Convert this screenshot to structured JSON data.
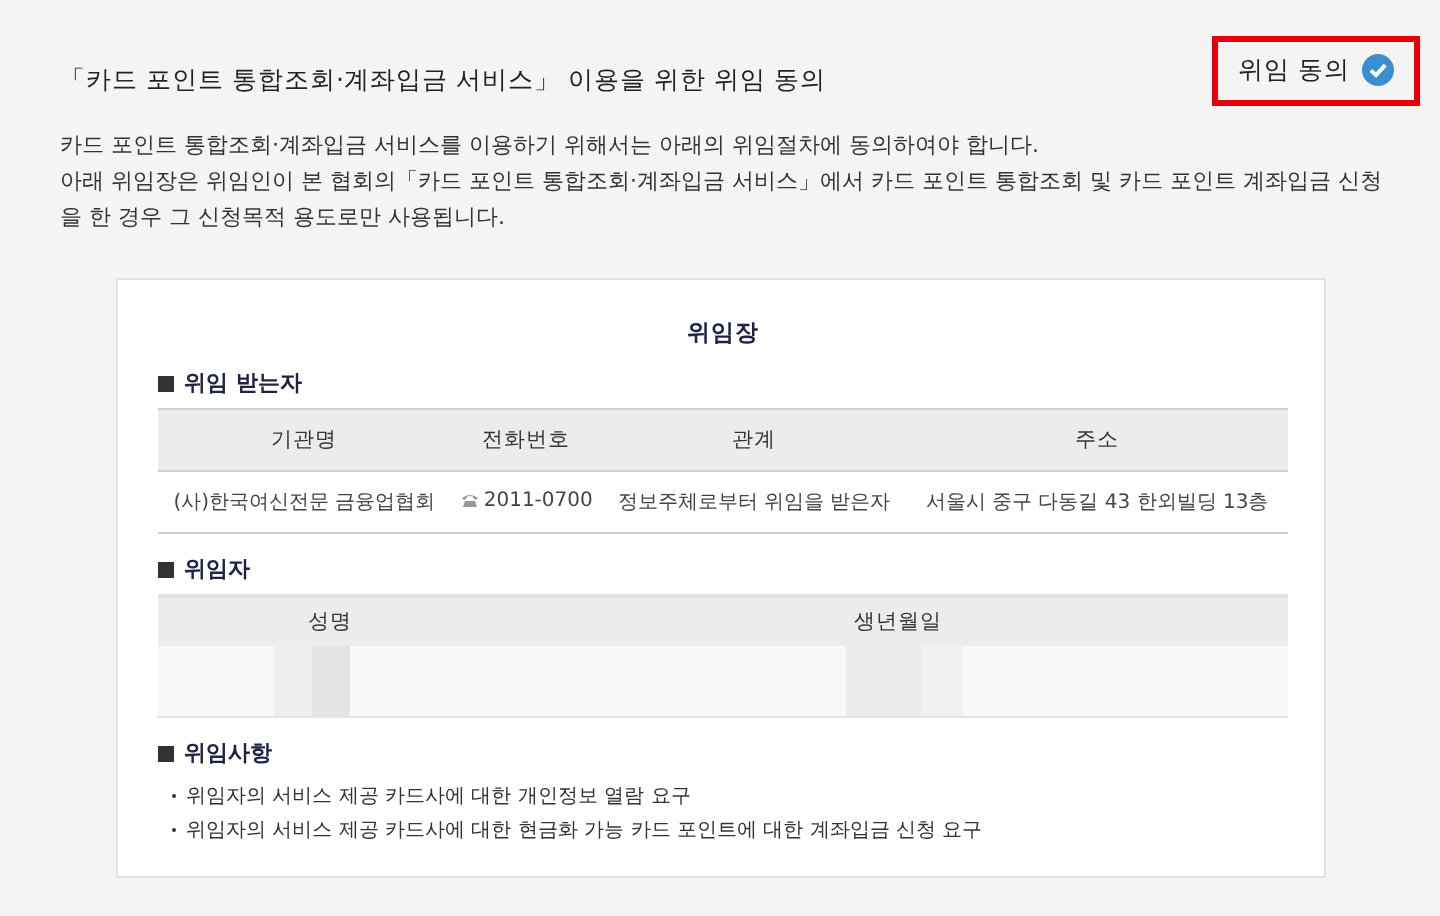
{
  "header": {
    "title": "「카드 포인트 통합조회·계좌입금 서비스」 이용을 위한 위임 동의",
    "consent": {
      "label": "위임 동의",
      "checked": true,
      "highlighted": true
    }
  },
  "intro": [
    "카드 포인트 통합조회·계좌입금 서비스를 이용하기 위해서는 아래의 위임절차에 동의하여야 합니다.",
    "아래 위임장은 위임인이 본 협회의「카드 포인트 통합조회·계좌입금 서비스」에서 카드 포인트 통합조회 및 카드 포인트 계좌입금 신청을 한 경우 그 신청목적 용도로만 사용됩니다."
  ],
  "document": {
    "title": "위임장",
    "grantee": {
      "heading": "위임 받는자",
      "columns": [
        "기관명",
        "전화번호",
        "관계",
        "주소"
      ],
      "row": [
        "(사)한국여신전문 금융업협회",
        "2011-0700",
        "정보주체로부터 위임을 받은자",
        "서울시 중구 다동길 43 한외빌딩 13층"
      ]
    },
    "grantor": {
      "heading": "위임자",
      "columns": [
        "성명",
        "생년월일"
      ]
    },
    "matters": {
      "heading": "위임사항",
      "items": [
        "위임자의 서비스 제공 카드사에 대한 개인정보 열람 요구",
        "위임자의 서비스 제공 카드사에 대한 현금화 가능 카드 포인트에 대한 계좌입금 신청 요구"
      ]
    }
  }
}
